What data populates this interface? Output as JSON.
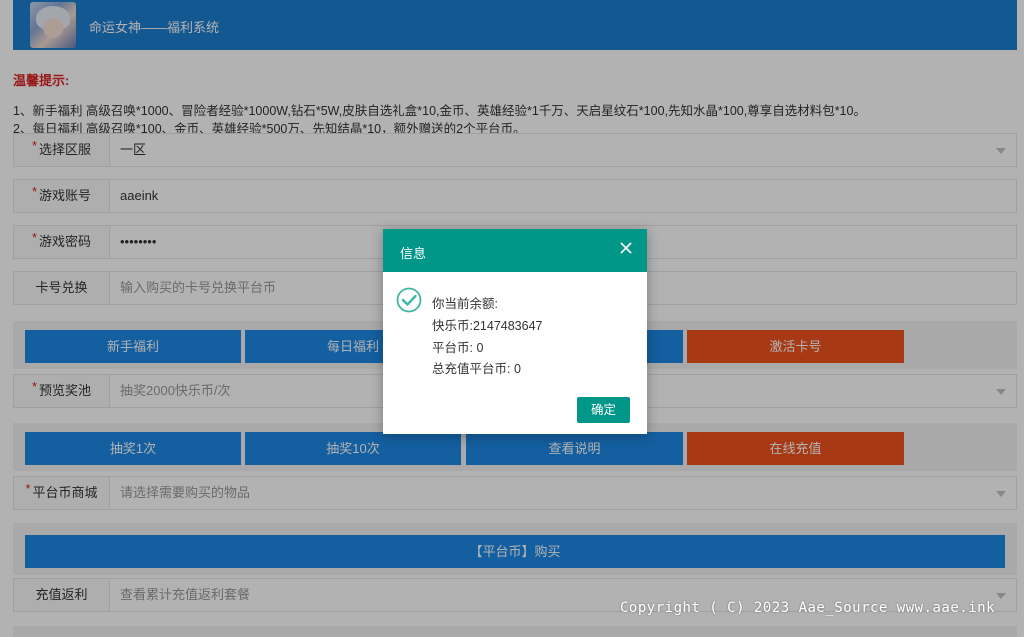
{
  "header": {
    "title": "命运女神——福利系统"
  },
  "tips": {
    "title": "温馨提示:",
    "line1": "1、新手福利 高级召唤*1000、冒险者经验*1000W,钻石*5W,皮肤自选礼盒*10,金币、英雄经验*1千万、天启星纹石*100,先知水晶*100,尊享自选材料包*10。",
    "line2": "2、每日福利 高级召唤*100、金币、英雄经验*500万、先知结晶*10，额外赠送的2个平台币。"
  },
  "form": {
    "server": {
      "label": "选择区服",
      "value": "一区"
    },
    "account": {
      "label": "游戏账号",
      "value": "aaeink"
    },
    "password": {
      "label": "游戏密码",
      "value": "••••••••"
    },
    "card": {
      "label": "卡号兑换",
      "placeholder": "输入购买的卡号兑换平台币"
    },
    "pool": {
      "label": "预览奖池",
      "value": "抽奖2000快乐币/次"
    },
    "mall": {
      "label": "平台币商城",
      "placeholder": "请选择需要购买的物品"
    },
    "rebate": {
      "label": "充值返利",
      "placeholder": "查看累计充值返利套餐"
    }
  },
  "buttons1": {
    "newbie": "新手福利",
    "daily": "每日福利",
    "activate": "激活卡号"
  },
  "buttons2": {
    "draw1": "抽奖1次",
    "draw10": "抽奖10次",
    "help": "查看说明",
    "recharge": "在线充值"
  },
  "buy_button": "【平台币】购买",
  "dialog": {
    "title": "信息",
    "line1": "你当前余额:",
    "line2": "快乐币:2147483647",
    "line3": "平台币: 0",
    "line4": "总充值平台币: 0",
    "ok": "确定"
  },
  "copyright": "Copyright ( C) 2023 Aae_Source www.aae.ink",
  "colors": {
    "header": "#1e7fd0",
    "blue_button": "#1e88e5",
    "red_button": "#f0531e",
    "dialog_accent": "#009688",
    "required": "#dd2222"
  }
}
